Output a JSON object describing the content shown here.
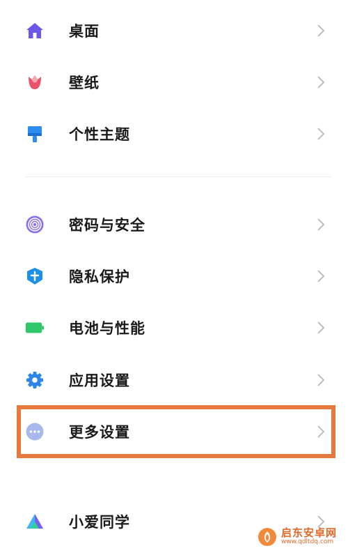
{
  "settings_groups": [
    {
      "items": [
        {
          "label": "桌面",
          "icon": "home-icon"
        },
        {
          "label": "壁纸",
          "icon": "flower-icon"
        },
        {
          "label": "个性主题",
          "icon": "paintbrush-icon"
        }
      ]
    },
    {
      "items": [
        {
          "label": "密码与安全",
          "icon": "fingerprint-icon"
        },
        {
          "label": "隐私保护",
          "icon": "shield-icon"
        },
        {
          "label": "电池与性能",
          "icon": "battery-icon"
        },
        {
          "label": "应用设置",
          "icon": "gear-icon"
        },
        {
          "label": "更多设置",
          "icon": "more-dots-icon"
        }
      ]
    },
    {
      "items": [
        {
          "label": "小爱同学",
          "icon": "xiaoai-icon"
        }
      ]
    }
  ],
  "highlight_color": "#e57a3f",
  "watermark": {
    "name": "启东安卓网",
    "url": "www.qdltdq.com"
  }
}
